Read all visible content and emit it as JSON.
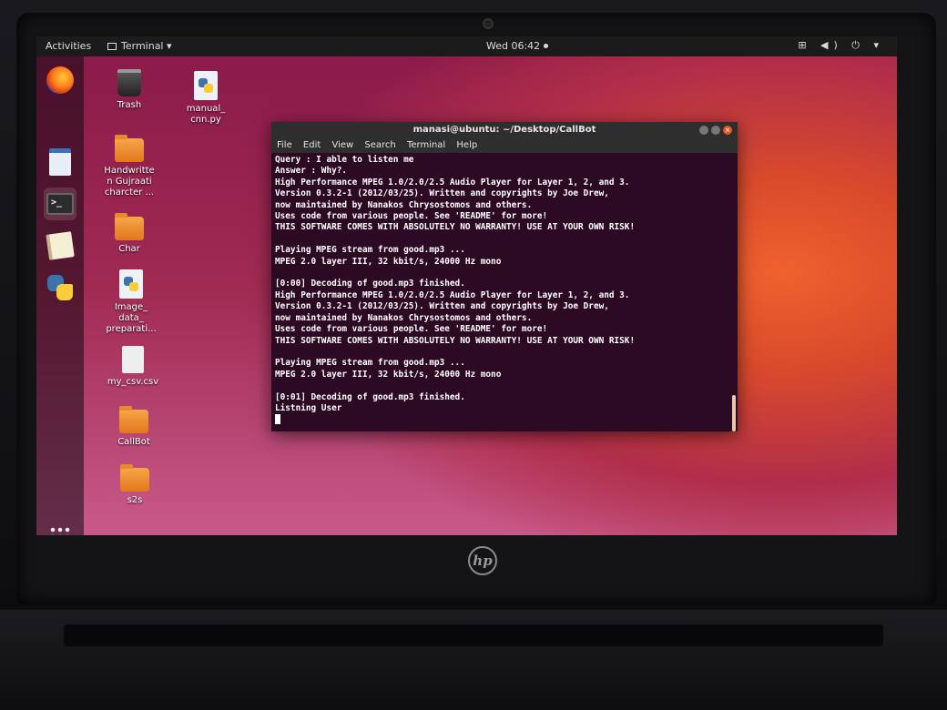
{
  "topbar": {
    "activities": "Activities",
    "app_menu": "Terminal ▾",
    "clock": "Wed 06:42",
    "tray": "⊞ ◀) ⏻ ▾"
  },
  "dock": {
    "items": [
      {
        "icon": "firefox-icon"
      },
      {
        "icon": "document-viewer-icon"
      },
      {
        "icon": "terminal-icon"
      },
      {
        "icon": "text-editor-icon"
      },
      {
        "icon": "python-icon"
      }
    ],
    "terminal_glyph": ">_"
  },
  "desktop": {
    "icons": [
      {
        "label": "Trash"
      },
      {
        "label": "manual_\ncnn.py"
      },
      {
        "label": "Handwritte\nn Gujraati\ncharcter ..."
      },
      {
        "label": "Char"
      },
      {
        "label": "Image_\ndata_\npreparati..."
      },
      {
        "label": "my_csv.csv"
      },
      {
        "label": "CallBot"
      },
      {
        "label": "s2s"
      }
    ]
  },
  "terminal": {
    "title": "manasi@ubuntu: ~/Desktop/CallBot",
    "close_glyph": "×",
    "menu": [
      "File",
      "Edit",
      "View",
      "Search",
      "Terminal",
      "Help"
    ],
    "output": "Query : I able to listen me\nAnswer : Why?.\nHigh Performance MPEG 1.0/2.0/2.5 Audio Player for Layer 1, 2, and 3.\nVersion 0.3.2-1 (2012/03/25). Written and copyrights by Joe Drew,\nnow maintained by Nanakos Chrysostomos and others.\nUses code from various people. See 'README' for more!\nTHIS SOFTWARE COMES WITH ABSOLUTELY NO WARRANTY! USE AT YOUR OWN RISK!\n\nPlaying MPEG stream from good.mp3 ...\nMPEG 2.0 layer III, 32 kbit/s, 24000 Hz mono\n\n[0:00] Decoding of good.mp3 finished.\nHigh Performance MPEG 1.0/2.0/2.5 Audio Player for Layer 1, 2, and 3.\nVersion 0.3.2-1 (2012/03/25). Written and copyrights by Joe Drew,\nnow maintained by Nanakos Chrysostomos and others.\nUses code from various people. See 'README' for more!\nTHIS SOFTWARE COMES WITH ABSOLUTELY NO WARRANTY! USE AT YOUR OWN RISK!\n\nPlaying MPEG stream from good.mp3 ...\nMPEG 2.0 layer III, 32 kbit/s, 24000 Hz mono\n\n[0:01] Decoding of good.mp3 finished.\nListning User"
  },
  "hardware": {
    "brand": "hp"
  },
  "colors": {
    "accent": "#e95420",
    "terminal_bg": "#2d0a24",
    "topbar_bg": "#1b1b1b"
  }
}
